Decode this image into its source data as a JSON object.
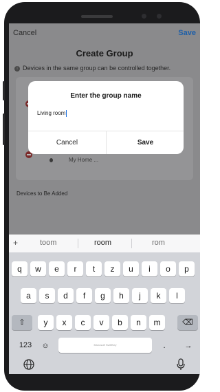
{
  "nav": {
    "cancel_label": "Cancel",
    "save_label": "Save"
  },
  "page": {
    "title": "Create Group",
    "hint": "Devices in the same group can be controlled together."
  },
  "device_list": {
    "sub_label": "My Home ..."
  },
  "devices_to_add_label": "Devices to Be Added",
  "dialog": {
    "title": "Enter the group name",
    "input_value": "Living room",
    "cancel_label": "Cancel",
    "save_label": "Save"
  },
  "keyboard": {
    "plus_label": "+",
    "suggestions": [
      "toom",
      "room",
      "rom"
    ],
    "row1": [
      "q",
      "w",
      "e",
      "r",
      "t",
      "z",
      "u",
      "i",
      "o",
      "p"
    ],
    "row2": [
      "a",
      "s",
      "d",
      "f",
      "g",
      "h",
      "j",
      "k",
      "l"
    ],
    "row3": [
      "y",
      "x",
      "c",
      "v",
      "b",
      "n",
      "m"
    ],
    "numbers_label": "123",
    "space_label": "Microsoft SwiftKey",
    "punct_label": ".",
    "shift_icon": "shift-icon",
    "backspace_icon": "backspace-icon",
    "emoji_icon": "emoji-icon",
    "enter_icon": "enter-arrow-icon",
    "globe_icon": "globe-icon",
    "mic_icon": "microphone-icon"
  }
}
